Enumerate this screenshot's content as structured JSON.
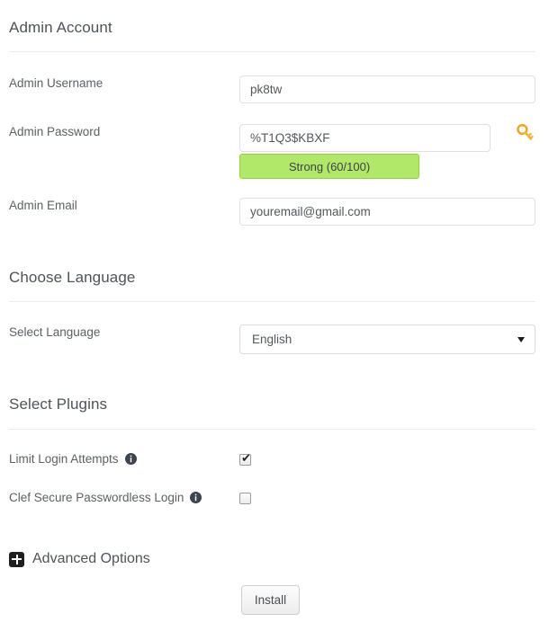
{
  "sections": {
    "admin_account": {
      "heading": "Admin Account",
      "fields": {
        "username": {
          "label": "Admin Username",
          "value": "pk8tw",
          "placeholder": "Admin Username"
        },
        "password": {
          "label": "Admin Password",
          "value": "%T1Q3$KBXF",
          "placeholder": "Admin Password"
        },
        "email": {
          "label": "Admin Email",
          "value": "youremail@gmail.com",
          "placeholder": "Admin Email"
        }
      },
      "password_strength": {
        "text": "Strong (60/100)",
        "score": 60,
        "max": 100,
        "level": "Strong",
        "fill_color": "#b2e869",
        "border_color": "#8ed43a"
      },
      "generate_password_icon": "key-icon"
    },
    "choose_language": {
      "heading": "Choose Language",
      "select": {
        "label": "Select Language",
        "value": "English",
        "options": [
          "English"
        ]
      }
    },
    "select_plugins": {
      "heading": "Select Plugins",
      "plugins": [
        {
          "label": "Limit Login Attempts",
          "checked": true,
          "info_icon": "info-icon"
        },
        {
          "label": "Clef Secure Passwordless Login",
          "checked": false,
          "info_icon": "info-icon"
        }
      ]
    },
    "advanced_options": {
      "label": "Advanced Options",
      "toggle_icon": "plus-square-icon",
      "expanded": false
    }
  },
  "actions": {
    "install_label": "Install"
  }
}
